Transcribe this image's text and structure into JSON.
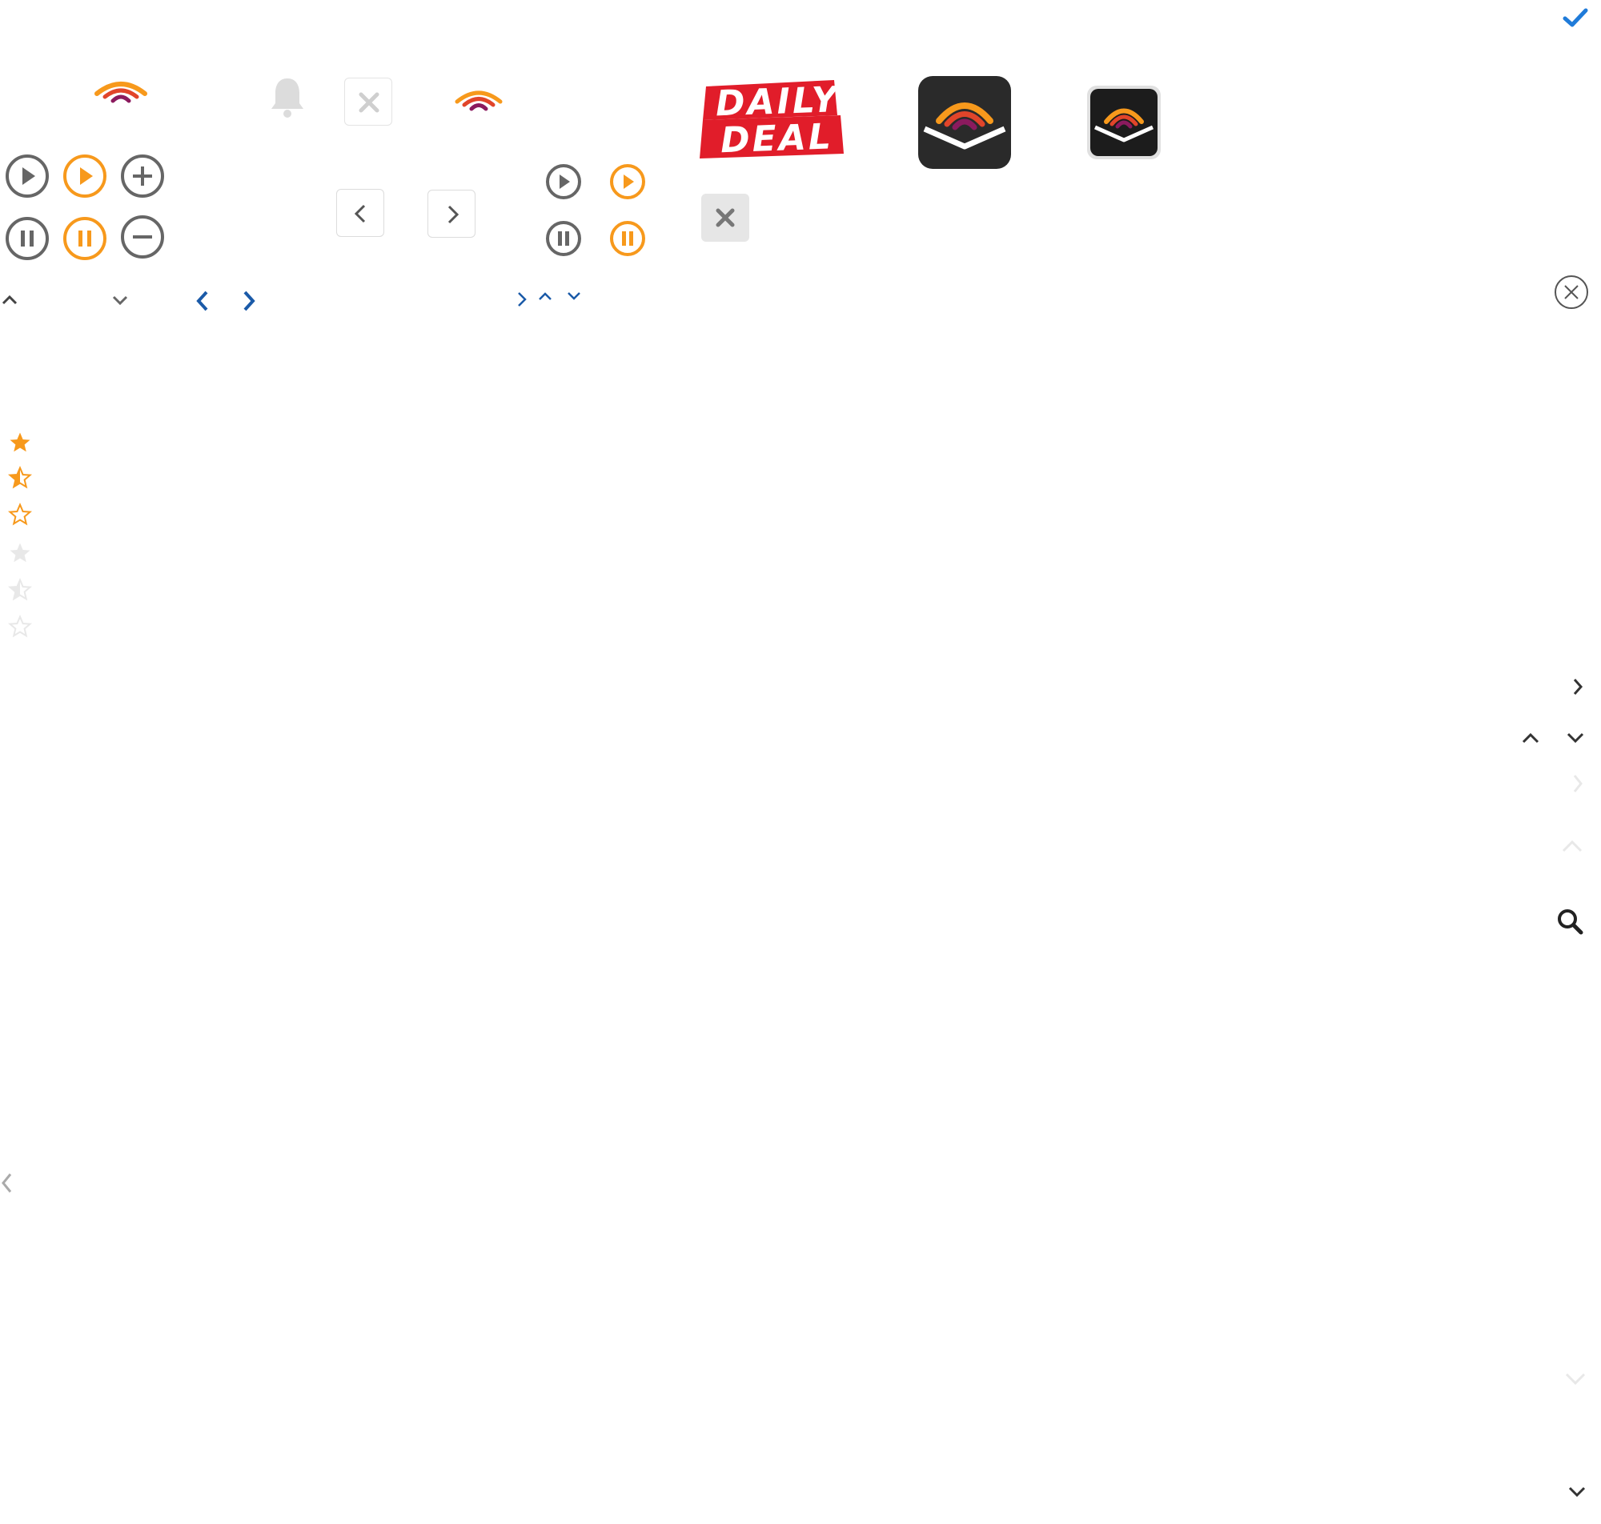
{
  "colors": {
    "accent_orange": "#f7991c",
    "icon_gray": "#666666",
    "link_blue": "#1a5aa8",
    "check_blue": "#1f7bd9",
    "banner_red": "#e11d2a",
    "app_icon_dark": "#2a2a2a",
    "star_empty": "#e8e8e8"
  },
  "sprites": {
    "logo_rainbow": "audible-wifi-logo-icon",
    "daily_deal": {
      "icon": "daily-deal-banner-icon",
      "line1": "DAILY",
      "line2": "DEAL"
    },
    "app_icon": "audible-app-icon",
    "play": "play-circle-icon",
    "pause": "pause-circle-icon",
    "add": "plus-circle-icon",
    "remove": "minus-circle-icon",
    "close": "close-icon",
    "bell": "bell-icon",
    "search": "search-icon",
    "check": "check-icon"
  },
  "ratings": {
    "active_orange": [
      1,
      0.5,
      0
    ],
    "inactive_gray": [
      1,
      0.5,
      0
    ]
  }
}
